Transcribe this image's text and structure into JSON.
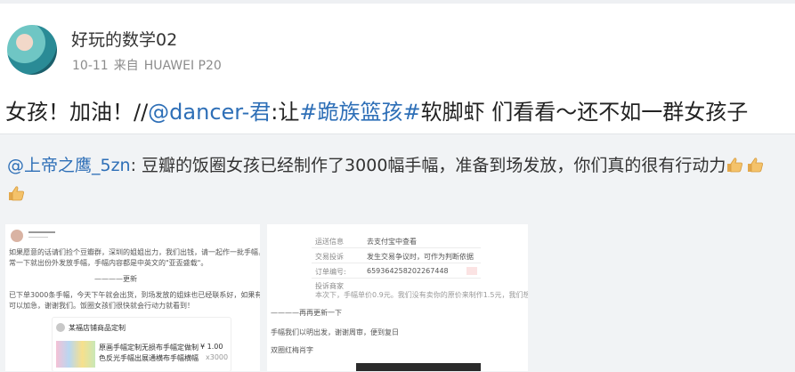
{
  "user": {
    "name": "好玩的数学02",
    "date": "10-11",
    "source_prefix": "来自",
    "device": "HUAWEI P20"
  },
  "post": {
    "text_before": "女孩！加油！//",
    "mention": "@dancer-君",
    "text_mid": ":让",
    "hashtag": "#跪族篮孩#",
    "text_after": "软脚虾 们看看～还不如一群女孩子"
  },
  "quote": {
    "mention": "@上帝之鹰_5zn",
    "text": ": 豆瓣的饭圈女孩已经制作了3000幅手幅，准备到场发放，你们真的很有行动力"
  },
  "image1": {
    "lines": [
      "如果愿意的话请们捡个豆瓣群，深圳的姐姐出力，我们出钱，请一起作一批手幅，深圳的姐妹平",
      "常一下就出份外发放手幅，手幅内容都是中英文的\"亚盃盛载\"。",
      "————更新",
      "已下单3000条手幅，今天下午就会出货，到场发放的姐妹也已经联系好，如果有还想要出力的，",
      "可以加急，谢谢我们。饭圈女孩们很快就会行动力就看到！"
    ],
    "card_title": "某福店铺商品定制",
    "card_text": "原画手幅定制无损布手幅定做制",
    "card_text2": "色反光手幅出展通横布手幅横幅",
    "price": "¥ 1.00",
    "qty": "x3000"
  },
  "image2": {
    "rows": [
      {
        "label": "运送信息",
        "value": "去支付宝中查看"
      },
      {
        "label": "交易投诉",
        "value": "发生交易争议时，可作为判断依据"
      },
      {
        "label": "订单编号:",
        "value": "659364258202267448"
      },
      {
        "label": "投诉商家",
        "value": ""
      }
    ],
    "note": "本次下，手幅单价0.9元。我们没有卖你的原价来制作1.5元，我们想让你把制作了3000条一共4300元",
    "update": "————再再更新一下",
    "line1": "手幅我们以明出发，谢谢周审，便到复日",
    "line2": "双圈红梅肖字"
  },
  "colors": {
    "link": "#2e6fb7",
    "meta": "#8c8c8c",
    "quote_bg": "#f1f3f5"
  }
}
